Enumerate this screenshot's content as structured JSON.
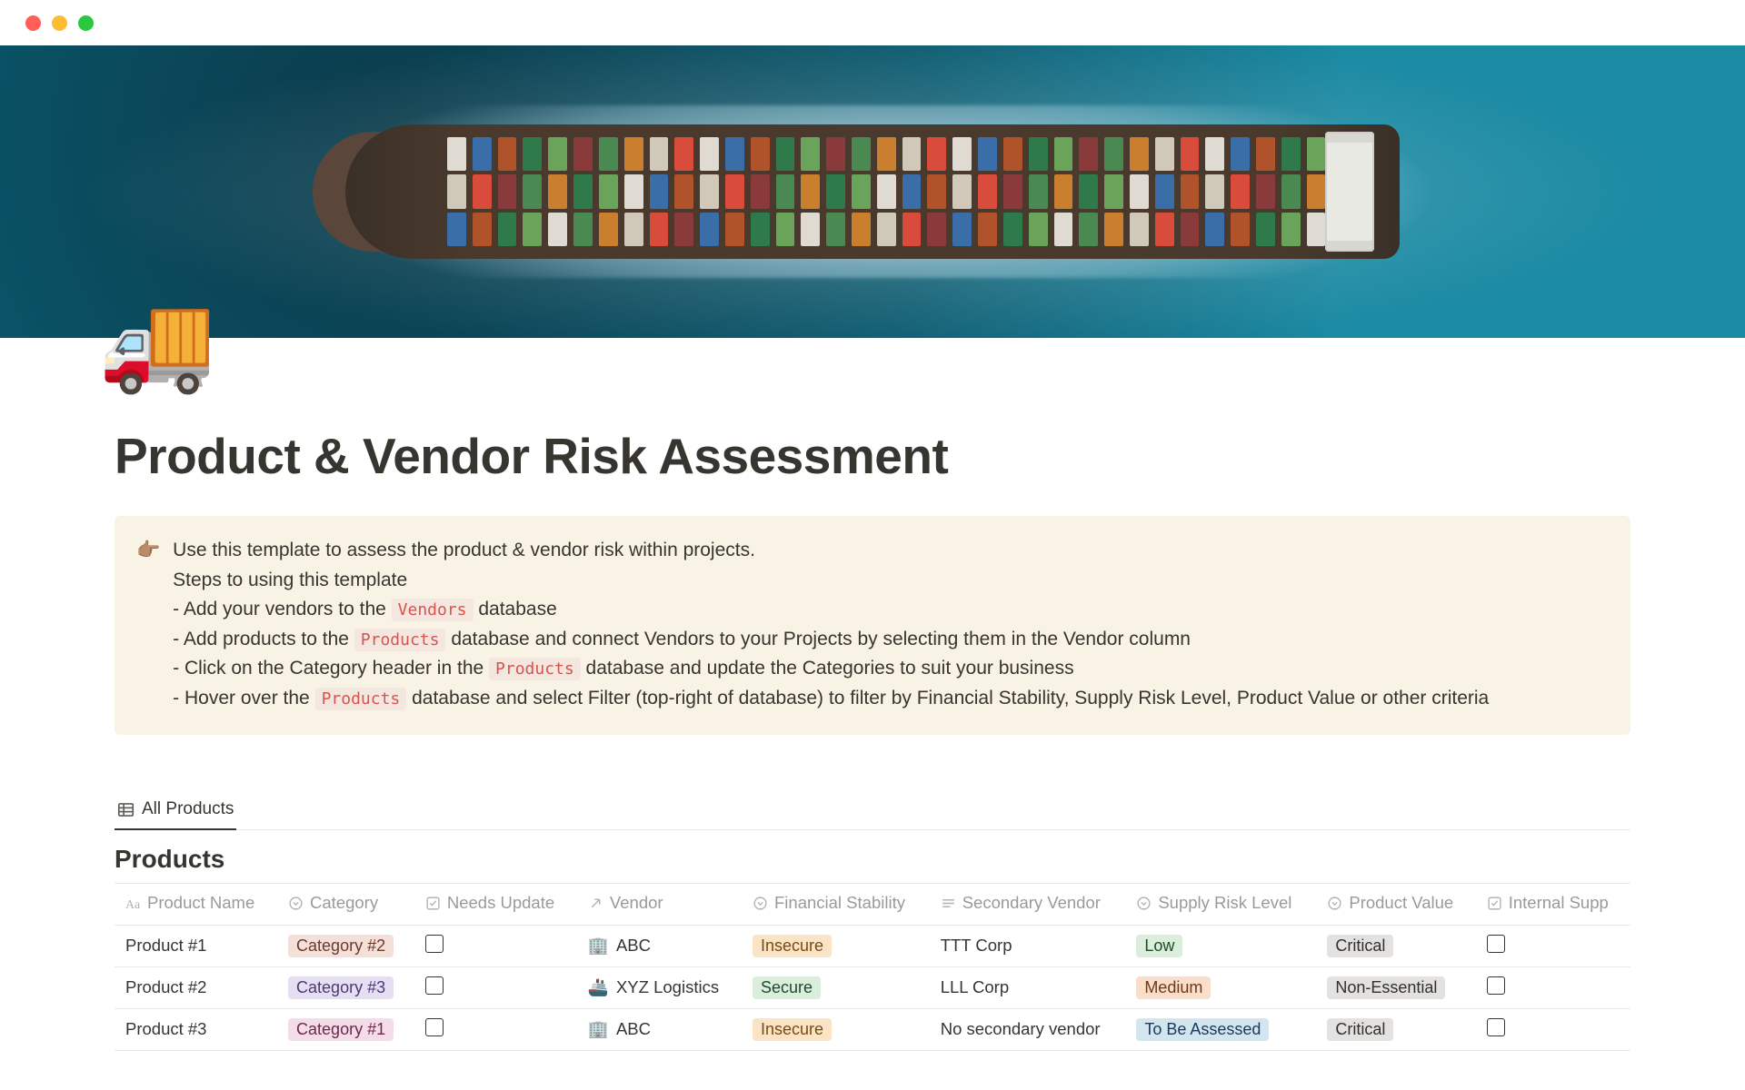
{
  "page": {
    "icon": "🚚",
    "title": "Product & Vendor Risk Assessment"
  },
  "callout": {
    "icon": "👉🏽",
    "line1": "Use this template to assess the product & vendor risk within projects.",
    "line2": "Steps to using this template",
    "step1_prefix": "- Add your vendors to the ",
    "vendors_chip": "Vendors",
    "step1_suffix": " database",
    "step2_prefix": "- Add products to the ",
    "products_chip": "Products",
    "step2_suffix": " database and connect Vendors to your Projects by selecting them in the Vendor column",
    "step3_prefix": "- Click on the Category header in the ",
    "step3_suffix": " database and update the Categories to suit your business",
    "step4_prefix": "- Hover over the ",
    "step4_suffix": " database and select Filter (top-right of database) to filter by Financial Stability, Supply Risk Level, Product Value or other criteria"
  },
  "database": {
    "tab_label": "All Products",
    "title": "Products",
    "columns": {
      "name": "Product Name",
      "category": "Category",
      "needs_update": "Needs Update",
      "vendor": "Vendor",
      "fin_stability": "Financial Stability",
      "secondary_vendor": "Secondary Vendor",
      "supply_risk": "Supply Risk Level",
      "product_value": "Product Value",
      "internal_supp": "Internal Supp"
    },
    "rows": [
      {
        "name": "Product #1",
        "category": "Category #2",
        "category_tone": "tag-peach",
        "vendor_icon": "🏢",
        "vendor": "ABC",
        "fin_stability": "Insecure",
        "fin_tone": "tag-orange",
        "secondary_vendor": "TTT Corp",
        "supply_risk": "Low",
        "supply_tone": "tag-green",
        "product_value": "Critical",
        "pv_tone": "tag-gray"
      },
      {
        "name": "Product #2",
        "category": "Category #3",
        "category_tone": "tag-purple",
        "vendor_icon": "🚢",
        "vendor": "XYZ Logistics",
        "fin_stability": "Secure",
        "fin_tone": "tag-green",
        "secondary_vendor": "LLL Corp",
        "supply_risk": "Medium",
        "supply_tone": "tag-orange2",
        "product_value": "Non-Essential",
        "pv_tone": "tag-gray"
      },
      {
        "name": "Product #3",
        "category": "Category #1",
        "category_tone": "tag-pink",
        "vendor_icon": "🏢",
        "vendor": "ABC",
        "fin_stability": "Insecure",
        "fin_tone": "tag-orange",
        "secondary_vendor": "No secondary vendor",
        "supply_risk": "To Be Assessed",
        "supply_tone": "tag-blue",
        "product_value": "Critical",
        "pv_tone": "tag-gray"
      }
    ]
  }
}
